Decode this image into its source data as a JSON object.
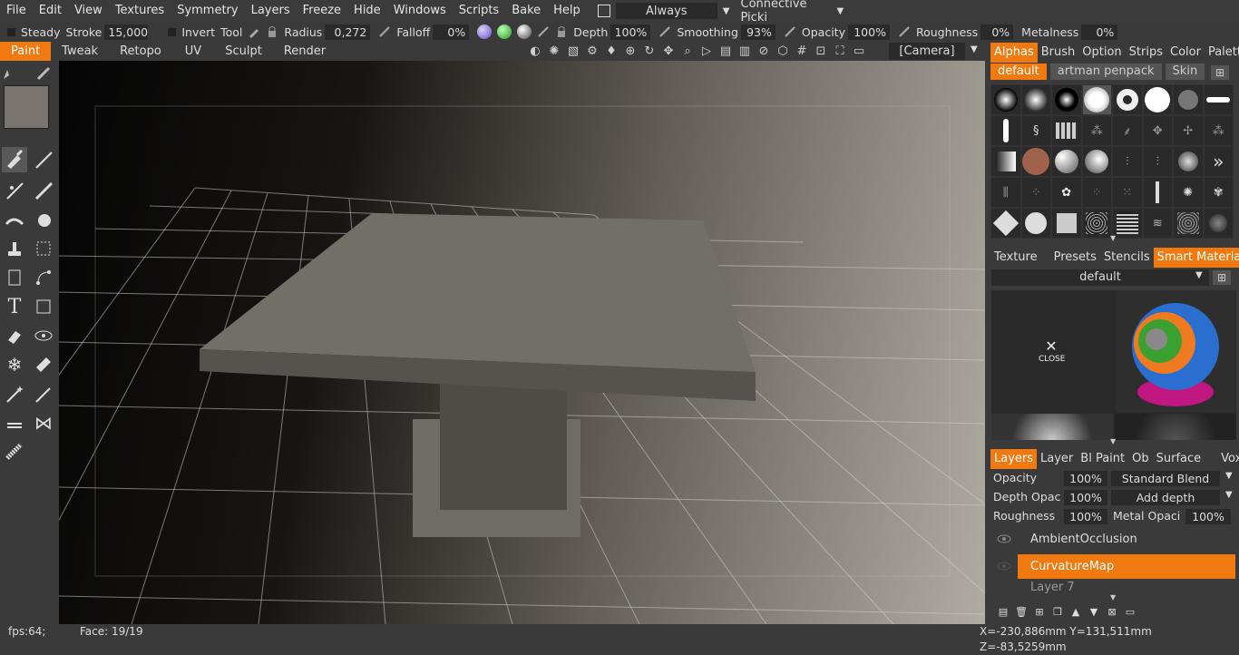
{
  "menu": [
    "File",
    "Edit",
    "View",
    "Textures",
    "Symmetry",
    "Layers",
    "Freeze",
    "Hide",
    "Windows",
    "Scripts",
    "Bake",
    "Help"
  ],
  "menu_right": {
    "always": "Always",
    "picking": "Connective Picki"
  },
  "toolopts": {
    "steady": "Steady",
    "stroke": "Stroke",
    "stroke_val": "15,000",
    "invert": "Invert",
    "tool": "Tool",
    "radius": "Radius",
    "radius_val": "0,272",
    "falloff": "Falloff",
    "falloff_val": "0%",
    "depth": "Depth",
    "depth_val": "100%",
    "smoothing": "Smoothing",
    "smoothing_val": "93%",
    "opacity": "Opacity",
    "opacity_val": "100%",
    "roughness": "Roughness",
    "roughness_val": "0%",
    "metalness": "Metalness",
    "metalness_val": "0%"
  },
  "rooms": [
    "Paint",
    "Tweak",
    "Retopo",
    "UV",
    "Sculpt",
    "Render"
  ],
  "active_room": "Paint",
  "camera": "[Camera]",
  "right_tabs_top": [
    "Alphas",
    "Brush",
    "Option",
    "Strips",
    "Color",
    "Palette"
  ],
  "alpha_presets": [
    "default",
    "artman penpack",
    "Skin"
  ],
  "right_tabs_mid": [
    "Texture",
    "Presets",
    "Stencils",
    "Smart Materials"
  ],
  "smart_material_select": "default",
  "close_label": "CLOSE",
  "right_tabs_bot": [
    "Layers",
    "Layer",
    "Bl Paint",
    "Ob",
    "Surface",
    "VoxTree"
  ],
  "layer_props": {
    "opacity": "Opacity",
    "opacity_val": "100%",
    "blend": "Standard Blend",
    "depth_opac": "Depth Opac",
    "depth_opac_val": "100%",
    "depth_mode": "Add depth",
    "roughness": "Roughness",
    "roughness_val": "100%",
    "metal_opac": "Metal Opaci",
    "metal_opac_val": "100%"
  },
  "layers": [
    "AmbientOcclusion",
    "CurvatureMap",
    "Layer 7"
  ],
  "status": {
    "fps": "fps:64;",
    "face": "Face: 19/19",
    "coords": "X=-230,886mm  Y=131,511mm  Z=-83,5259mm"
  },
  "colors": {
    "accent": "#f07a10",
    "panel": "#3a3a3a",
    "field": "#2a2a2a"
  }
}
